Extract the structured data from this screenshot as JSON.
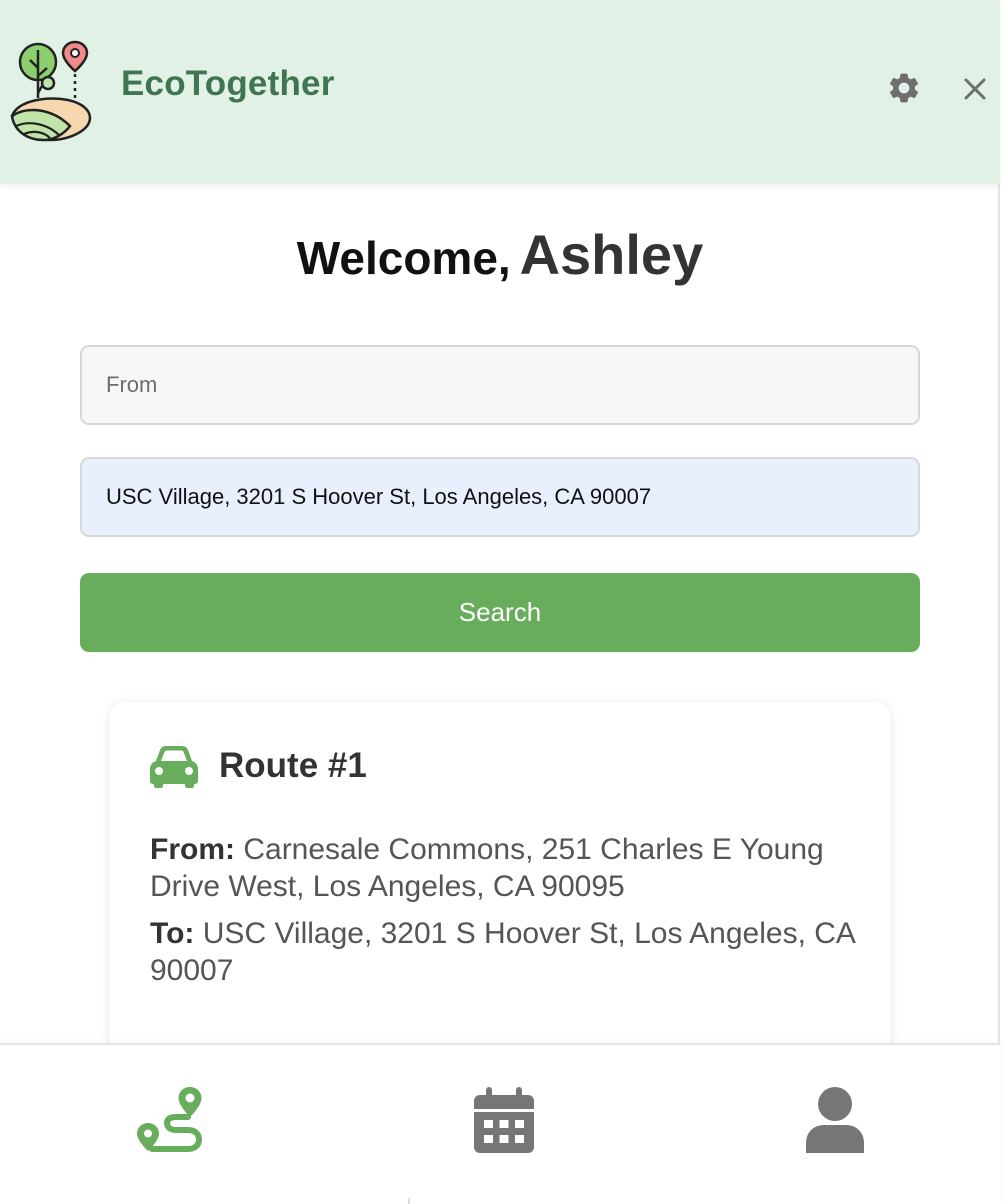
{
  "header": {
    "app_name": "EcoTogether",
    "logo_icon": "leaf-tree-map-pin-logo",
    "settings_icon": "gear-icon",
    "close_icon": "close-icon"
  },
  "welcome": {
    "greeting": "Welcome,",
    "name": "Ashley"
  },
  "search": {
    "from_placeholder": "From",
    "from_value": "",
    "to_value": "USC Village, 3201 S Hoover St, Los Angeles, CA 90007",
    "button_label": "Search"
  },
  "route": {
    "icon": "car-icon",
    "title": "Route #1",
    "from_label": "From:",
    "from_value": "Carnesale Commons, 251 Charles E Young Drive West, Los Angeles, CA 90095",
    "to_label": "To:",
    "to_value": "USC Village, 3201 S Hoover St, Los Angeles, CA 90007"
  },
  "nav": {
    "items": [
      {
        "icon": "route-icon",
        "active": true
      },
      {
        "icon": "calendar-icon",
        "active": false
      },
      {
        "icon": "user-icon",
        "active": false
      }
    ]
  },
  "colors": {
    "brand_green": "#3f7651",
    "accent_green": "#67ad5b",
    "header_bg": "#e1f1e6",
    "icon_gray": "#767676"
  }
}
